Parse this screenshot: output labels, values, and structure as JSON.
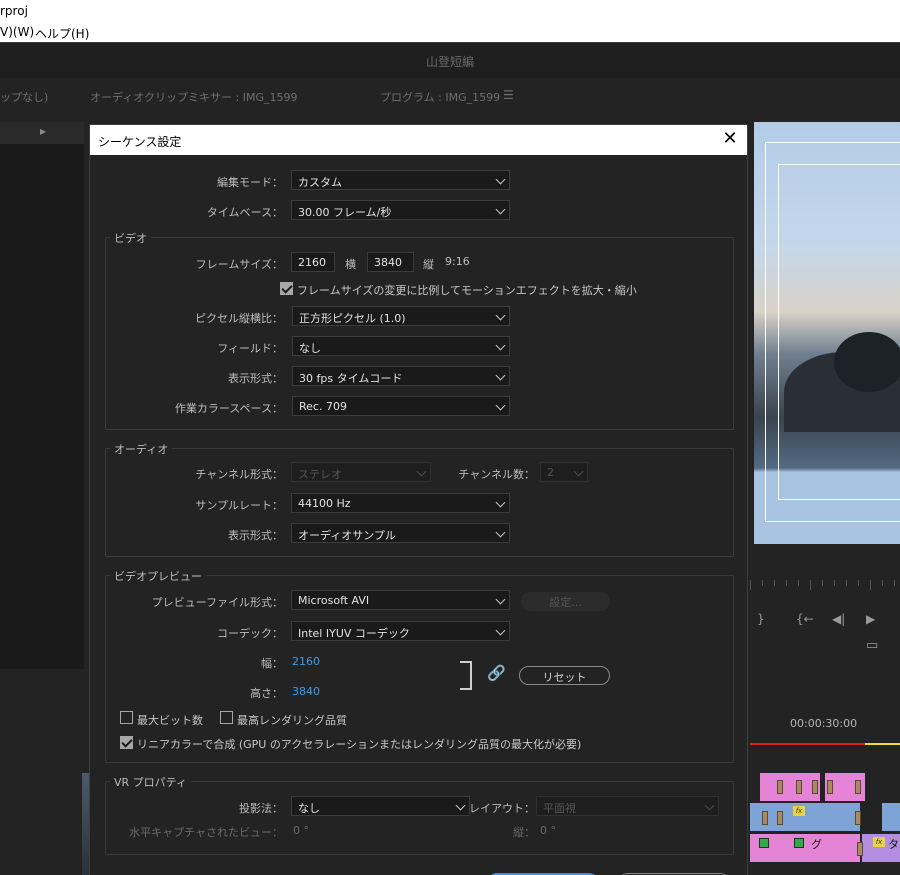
{
  "window": {
    "title_fragment": "rproj",
    "menu": [
      "V)(W)",
      "ヘルプ(H)"
    ],
    "app_title": "山登短編"
  },
  "panels": {
    "left_header": "ップなし)",
    "mixer_header": "オーディオクリップミキサー : IMG_1599",
    "program_header": "プログラム : IMG_1599"
  },
  "timeline": {
    "timecode": "00:00:30:00",
    "clip_label_1": "グ",
    "clip_label_2": "タ",
    "fx": "fx"
  },
  "dialog": {
    "title": "シーケンス設定",
    "edit_mode": {
      "label": "編集モード：",
      "value": "カスタム"
    },
    "timebase": {
      "label": "タイムベース：",
      "value": "30.00  フレーム/秒"
    },
    "video": {
      "title": "ビデオ",
      "frame_size_label": "フレームサイズ：",
      "width": "2160",
      "width_label": "横",
      "height": "3840",
      "height_label": "縦",
      "aspect": "9:16",
      "scale_checkbox": "フレームサイズの変更に比例してモーションエフェクトを拡大・縮小",
      "pixel_aspect": {
        "label": "ピクセル縦横比：",
        "value": "正方形ピクセル (1.0)"
      },
      "fields": {
        "label": "フィールド：",
        "value": "なし"
      },
      "display_format": {
        "label": "表示形式：",
        "value": "30 fps タイムコード"
      },
      "color_space": {
        "label": "作業カラースペース：",
        "value": "Rec. 709"
      }
    },
    "audio": {
      "title": "オーディオ",
      "channel_format": {
        "label": "チャンネル形式：",
        "value": "ステレオ"
      },
      "channel_count": {
        "label": "チャンネル数：",
        "value": "2"
      },
      "sample_rate": {
        "label": "サンプルレート：",
        "value": "44100 Hz"
      },
      "display_format": {
        "label": "表示形式：",
        "value": "オーディオサンプル"
      }
    },
    "preview": {
      "title": "ビデオプレビュー",
      "file_format": {
        "label": "プレビューファイル形式：",
        "value": "Microsoft AVI"
      },
      "settings_button": "設定...",
      "codec": {
        "label": "コーデック：",
        "value": "Intel IYUV コーデック"
      },
      "width": {
        "label": "幅：",
        "value": "2160"
      },
      "height": {
        "label": "高さ：",
        "value": "3840"
      },
      "reset_button": "リセット",
      "max_bit_depth": "最大ビット数",
      "max_render_quality": "最高レンダリング品質",
      "linear_color": "リニアカラーで合成 (GPU のアクセラレーションまたはレンダリング品質の最大化が必要)"
    },
    "vr": {
      "title": "VR プロパティ",
      "projection": {
        "label": "投影法：",
        "value": "なし"
      },
      "layout": {
        "label": "レイアウト：",
        "value": "平面視"
      },
      "h_view": {
        "label": "水平キャプチャされたビュー：",
        "value": "0 °"
      },
      "v_view": {
        "label": "縦：",
        "value": "0 °"
      }
    }
  }
}
